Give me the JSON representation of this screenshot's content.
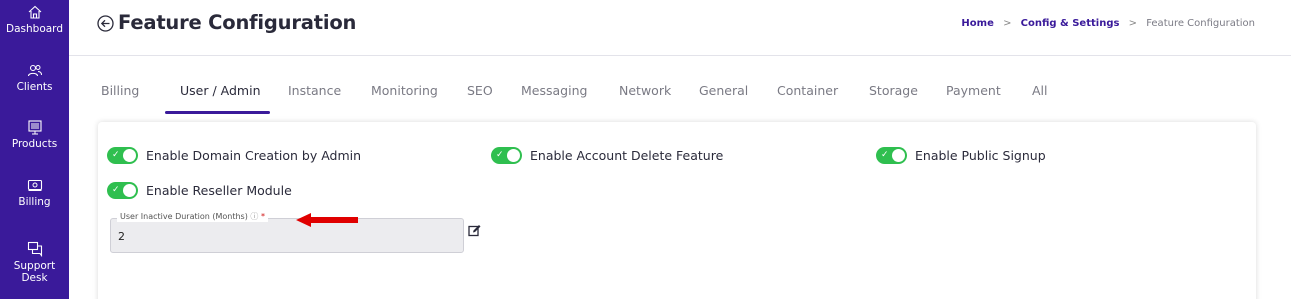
{
  "sidebar": {
    "items": [
      {
        "label": "Dashboard",
        "icon": "home-icon"
      },
      {
        "label": "Clients",
        "icon": "users-icon"
      },
      {
        "label": "Products",
        "icon": "products-icon"
      },
      {
        "label": "Billing",
        "icon": "billing-icon"
      },
      {
        "label": "Support Desk",
        "icon": "support-icon"
      }
    ]
  },
  "header": {
    "title": "Feature Configuration",
    "breadcrumb": {
      "home": "Home",
      "config": "Config & Settings",
      "current": "Feature Configuration",
      "separator": ">"
    }
  },
  "tabs": [
    {
      "label": "Billing"
    },
    {
      "label": "User / Admin",
      "active": true
    },
    {
      "label": "Instance"
    },
    {
      "label": "Monitoring"
    },
    {
      "label": "SEO"
    },
    {
      "label": "Messaging"
    },
    {
      "label": "Network"
    },
    {
      "label": "General"
    },
    {
      "label": "Container"
    },
    {
      "label": "Storage"
    },
    {
      "label": "Payment"
    },
    {
      "label": "All"
    }
  ],
  "settings": {
    "toggles": [
      {
        "label": "Enable Domain Creation by Admin",
        "on": true
      },
      {
        "label": "Enable Account Delete Feature",
        "on": true
      },
      {
        "label": "Enable Public Signup",
        "on": true
      },
      {
        "label": "Enable Reseller Module",
        "on": true
      }
    ],
    "inactive_duration": {
      "label": "User Inactive Duration (Months)",
      "help": "?",
      "required": "*",
      "value": "2"
    }
  },
  "colors": {
    "sidebar": "#3a1a9a",
    "accent": "#3a1a9a",
    "toggle_on": "#2fbf4f",
    "annotation_arrow": "#e00000"
  }
}
